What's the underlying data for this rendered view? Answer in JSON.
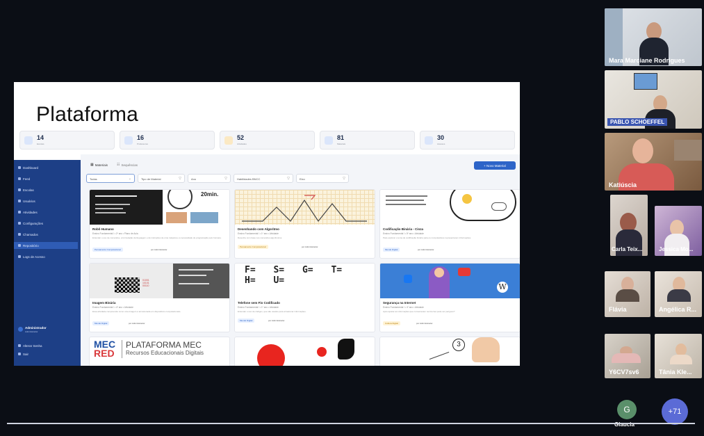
{
  "slide": {
    "title": "Plataforma",
    "stats": [
      {
        "num": "14",
        "sub": "Escolas",
        "icon": "school-icon"
      },
      {
        "num": "16",
        "sub": "Professores",
        "icon": "people-icon"
      },
      {
        "num": "52",
        "sub": "Atividades",
        "icon": "folder-icon"
      },
      {
        "num": "81",
        "sub": "Materiais",
        "icon": "document-icon"
      },
      {
        "num": "30",
        "sub": "Acessos",
        "icon": "archive-icon"
      }
    ]
  },
  "sidebar": {
    "items": [
      {
        "label": "Dashboard",
        "icon": "grid-icon"
      },
      {
        "label": "Feed",
        "icon": "feed-icon"
      },
      {
        "label": "Escolas",
        "icon": "school-icon"
      },
      {
        "label": "Usuários",
        "icon": "users-icon"
      },
      {
        "label": "Atividades",
        "icon": "activity-icon"
      },
      {
        "label": "Configurações",
        "icon": "gear-icon"
      },
      {
        "label": "Chamados",
        "icon": "ticket-icon"
      },
      {
        "label": "Repositório",
        "icon": "repository-icon"
      },
      {
        "label": "Logs de Acesso",
        "icon": "log-icon"
      }
    ],
    "user": {
      "name": "Administrador",
      "role": "Administrador"
    },
    "bottom": [
      {
        "label": "Alterar Senha",
        "icon": "key-icon"
      },
      {
        "label": "Sair",
        "icon": "logout-icon"
      }
    ]
  },
  "main": {
    "tabs": [
      {
        "label": "Materiais"
      },
      {
        "label": "Sequências"
      }
    ],
    "new_button": "+ Novo Material",
    "filters": [
      {
        "label": "Todas"
      },
      {
        "label": "Tipo de Material"
      },
      {
        "label": "Ano"
      },
      {
        "label": "Habilidades BNCC"
      },
      {
        "label": "Eixo"
      }
    ],
    "cards": [
      {
        "title": "Robô Humano",
        "meta": "Ensino Fundamental I • 2º ano • Plano de Aula",
        "desc": "Entender o uso de comandos, a formulação da linguagem e de instruções de uma máquina e a necessidade de programação pelo humano.",
        "tag": "Pensamento Computacional",
        "author": "por Administrador",
        "thumb_text": "20min."
      },
      {
        "title": "Desenhando com Algoritmo",
        "meta": "Ensino Fundamental I • 1º ano • Atividade",
        "desc": "Desenhe com base nos comandos algorítmicos.",
        "tag": "Pensamento Computacional",
        "author": "por Administrador",
        "thumb_text": ""
      },
      {
        "title": "Codificação Binária - Cinza",
        "meta": "Ensino Fundamental I • 5º ano • Atividade",
        "desc": "Para explorar o tema de codificação binária para os computadores representarem informações.",
        "tag": "Mundo Digital",
        "author": "por Administrador",
        "thumb_text": ""
      },
      {
        "title": "Imagem Binária",
        "meta": "Ensino Fundamental I • 4º ano • Atividade",
        "desc": "Essa atividade compreende como uma imagem é armazenada em dispositivos computacionais.",
        "tag": "Mundo Digital",
        "author": "por Administrador",
        "thumb_text": ""
      },
      {
        "title": "Telefone sem Fio Codificado",
        "meta": "Ensino Fundamental I • 1º ano • Atividade",
        "desc": "Entender o uso de códigos, que são usados para armazenar informações.",
        "tag": "Mundo Digital",
        "author": "por Administrador",
        "thumb_text": "F= S= G= T= H= U="
      },
      {
        "title": "Segurança na Internet",
        "meta": "Ensino Fundamental I • 4º ano • Atividade",
        "desc": "Após ajustar as informações que conversaram na internet pode ser perigoso?",
        "tag": "Cultura Digital",
        "author": "por Administrador",
        "thumb_text": ""
      },
      {
        "title": "",
        "meta": "",
        "desc": "",
        "tag": "",
        "author": "",
        "thumb_text": "PLATAFORMA MEC"
      },
      {
        "title": "",
        "meta": "",
        "desc": "",
        "tag": "",
        "author": "",
        "thumb_text": ""
      },
      {
        "title": "",
        "meta": "",
        "desc": "",
        "tag": "",
        "author": "",
        "thumb_text": "3"
      }
    ],
    "mec_logo_top": "MEC",
    "mec_logo_bottom": "RED",
    "mec_subtitle": "Recursos Educacionais Digitais"
  },
  "participants": [
    {
      "name": "Mara Marciane Rodrigues"
    },
    {
      "name": "PABLO SCHOEFFEL"
    },
    {
      "name": "Katiúscia"
    },
    {
      "name": "Carla Teix..."
    },
    {
      "name": "Jessica Mo..."
    },
    {
      "name": "Flávia"
    },
    {
      "name": "Angélica R..."
    },
    {
      "name": "Y6CV7sv6"
    },
    {
      "name": "Tânia Kle..."
    }
  ],
  "bottom_avatars": [
    {
      "initial": "G",
      "name": "Glaucia",
      "color": "#5a8f6a"
    },
    {
      "initial": "+71",
      "name": "",
      "color": "#5b6bd6"
    }
  ]
}
